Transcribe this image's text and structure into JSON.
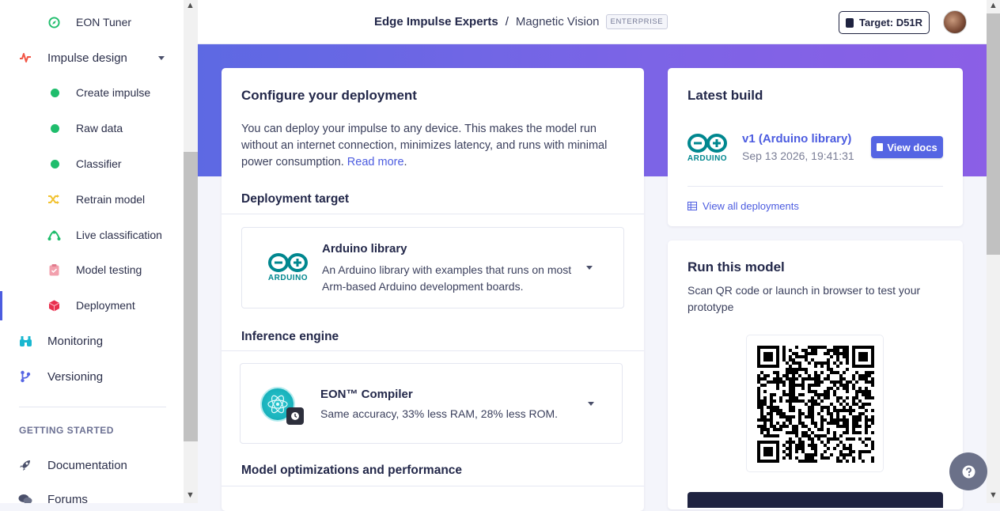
{
  "sidebar": {
    "items": [
      {
        "label": "EON Tuner",
        "icon": "eon-tuner-icon"
      },
      {
        "label": "Impulse design",
        "icon": "impulse-design-icon"
      },
      {
        "label": "Create impulse",
        "icon": "dot-icon"
      },
      {
        "label": "Raw data",
        "icon": "dot-icon"
      },
      {
        "label": "Classifier",
        "icon": "dot-icon"
      },
      {
        "label": "Retrain model",
        "icon": "shuffle-icon"
      },
      {
        "label": "Live classification",
        "icon": "live-icon"
      },
      {
        "label": "Model testing",
        "icon": "clipboard-icon"
      },
      {
        "label": "Deployment",
        "icon": "cube-icon"
      },
      {
        "label": "Monitoring",
        "icon": "binoculars-icon"
      },
      {
        "label": "Versioning",
        "icon": "branch-icon"
      },
      {
        "label": "Documentation",
        "icon": "rocket-icon"
      },
      {
        "label": "Forums",
        "icon": "chat-icon"
      }
    ],
    "getting_started": "GETTING STARTED"
  },
  "header": {
    "org": "Edge Impulse Experts",
    "separator": "/",
    "project": "Magnetic Vision",
    "badge": "ENTERPRISE",
    "target": "Target: D51R"
  },
  "configure": {
    "title": "Configure your deployment",
    "description": "You can deploy your impulse to any device. This makes the model run without an internet connection, minimizes latency, and runs with minimal power consumption.",
    "read_more": "Read more",
    "read_more_suffix": ".",
    "target_section": "Deployment target",
    "target_name": "Arduino library",
    "target_desc": "An Arduino library with examples that runs on most Arm-based Arduino development boards.",
    "arduino_logo_text": "ARDUINO",
    "engine_section": "Inference engine",
    "engine_name": "EON™ Compiler",
    "engine_desc": "Same accuracy, 33% less RAM, 28% less ROM.",
    "optim_section": "Model optimizations and performance"
  },
  "latest_build": {
    "title": "Latest build",
    "build_name": "v1 (Arduino library)",
    "build_date": "Sep 13 2026, 19:41:31",
    "view_docs": "View docs",
    "view_all": "View all deployments",
    "arduino_logo_text": "ARDUINO"
  },
  "run_model": {
    "title": "Run this model",
    "description": "Scan QR code or launch in browser to test your prototype"
  },
  "colors": {
    "accent": "#4c5ce0",
    "banner_start": "#5d69e3",
    "banner_end": "#8b5fe6",
    "arduino": "#00878f",
    "status_green": "#1fbd6c"
  }
}
